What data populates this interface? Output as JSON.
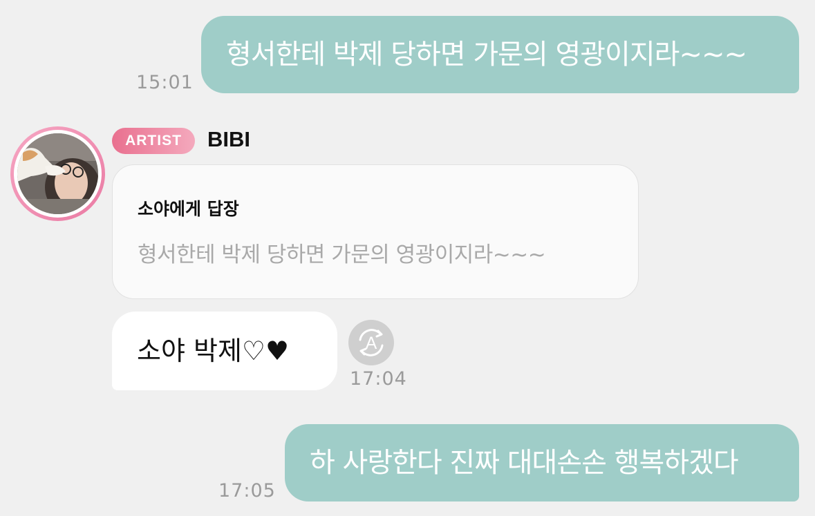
{
  "messages": [
    {
      "text": "형서한테 박제 당하면 가문의 영광이지라~~~",
      "time": "15:01"
    },
    {
      "text": "하 사랑한다 진짜 대대손손 행복하겠다",
      "time": "17:05"
    }
  ],
  "artist_message": {
    "badge": "ARTIST",
    "sender": "BIBI",
    "reply_title": "소야에게 답장",
    "reply_quote": "형서한테 박제 당하면 가문의 영광이지라~~~",
    "text": "소야 박제♡♥",
    "time": "17:04",
    "translate_icon_letter": "A"
  },
  "colors": {
    "outgoing_bubble": "#9fcdc8",
    "artist_badge": "#e9708f",
    "background": "#f0f0f0"
  },
  "icons": {
    "translate": "translate-icon",
    "avatar": "profile-photo"
  }
}
